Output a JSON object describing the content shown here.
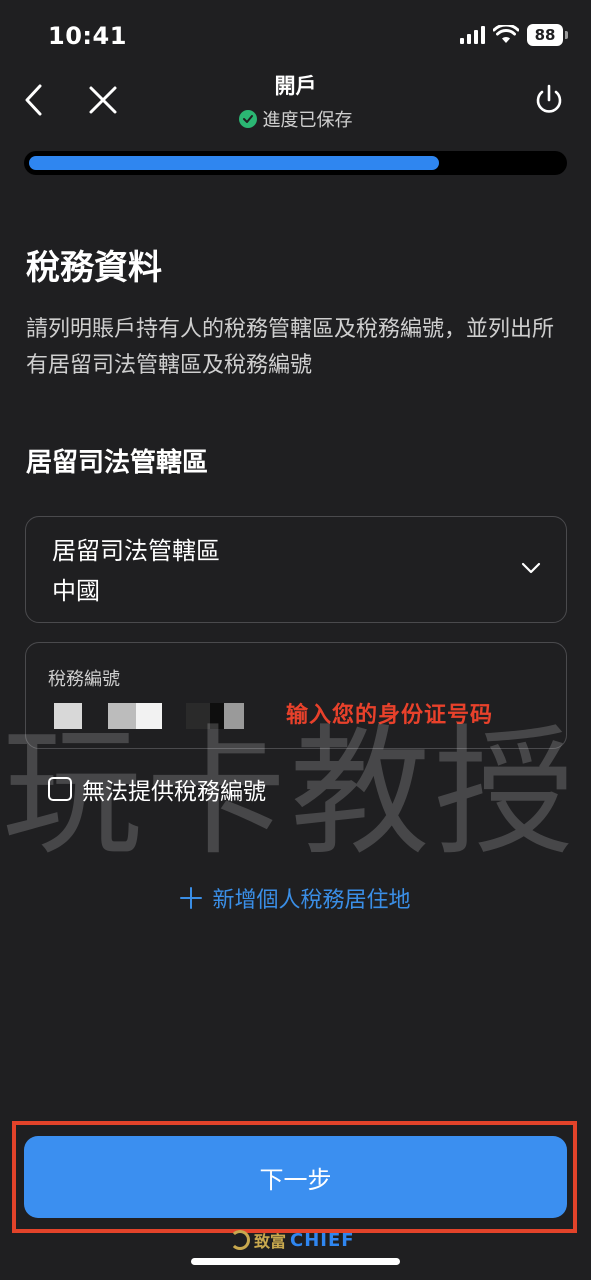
{
  "status_bar": {
    "time": "10:41",
    "battery": "88",
    "icons": [
      "signal-icon",
      "wifi-icon",
      "battery-icon"
    ]
  },
  "nav": {
    "title": "開戶",
    "subtitle": "進度已保存",
    "back_icon": "chevron-left-icon",
    "close_icon": "close-icon",
    "power_icon": "power-icon"
  },
  "progress": {
    "fraction": 0.77
  },
  "page": {
    "heading": "稅務資料",
    "description": "請列明賬戶持有人的稅務管轄區及稅務編號，並列出所有居留司法管轄區及稅務編號",
    "section_label": "居留司法管轄區"
  },
  "form": {
    "jurisdiction": {
      "label": "居留司法管轄區",
      "value": "中國"
    },
    "tax_number": {
      "label": "稅務編號"
    },
    "annotation": "输入您的身份证号码",
    "checkbox_label": "無法提供稅務編號",
    "add_link": "新增個人稅務居住地"
  },
  "watermark": "玩卡教授",
  "footer": {
    "next_button": "下一步",
    "brand_cn": "致富",
    "brand_en": "CHIEF"
  },
  "colors": {
    "background": "#1f1f21",
    "accent": "#3b8ff0",
    "success": "#2bb673",
    "annotation": "#e8412b"
  }
}
